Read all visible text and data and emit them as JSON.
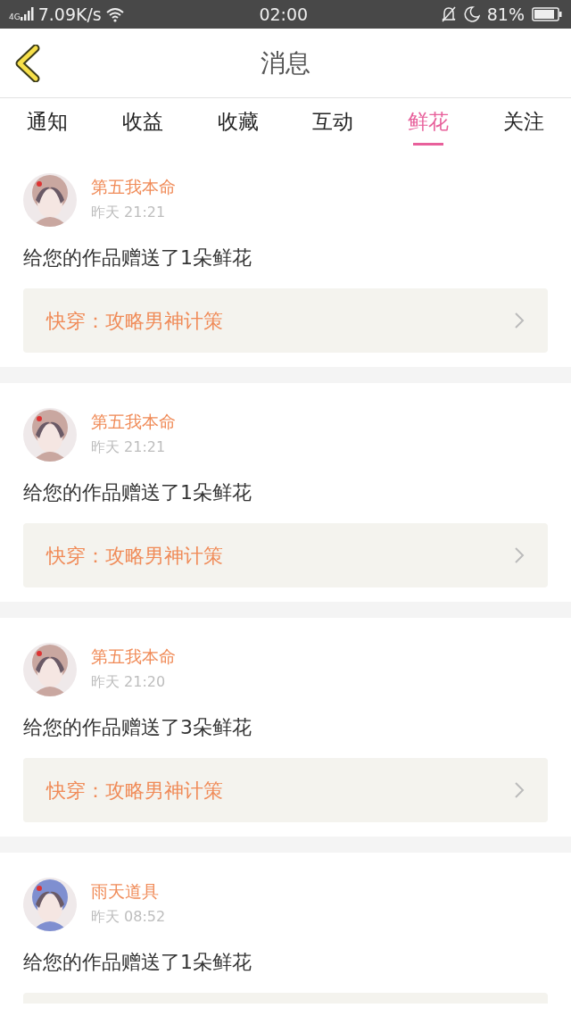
{
  "status_bar": {
    "network": "4G",
    "speed": "7.09K/s",
    "time": "02:00",
    "battery": "81%"
  },
  "header": {
    "title": "消息"
  },
  "tabs": [
    {
      "label": "通知",
      "selected": false
    },
    {
      "label": "收益",
      "selected": false
    },
    {
      "label": "收藏",
      "selected": false
    },
    {
      "label": "互动",
      "selected": false
    },
    {
      "label": "鲜花",
      "selected": true
    },
    {
      "label": "关注",
      "selected": false
    }
  ],
  "messages": [
    {
      "user": "第五我本命",
      "time": "昨天 21:21",
      "text": "给您的作品赠送了1朵鲜花",
      "book": "快穿：攻略男神计策"
    },
    {
      "user": "第五我本命",
      "time": "昨天 21:21",
      "text": "给您的作品赠送了1朵鲜花",
      "book": "快穿：攻略男神计策"
    },
    {
      "user": "第五我本命",
      "time": "昨天 21:20",
      "text": "给您的作品赠送了3朵鲜花",
      "book": "快穿：攻略男神计策"
    },
    {
      "user": "雨天道具",
      "time": "昨天 08:52",
      "text": "给您的作品赠送了1朵鲜花",
      "book_cut": true
    }
  ]
}
